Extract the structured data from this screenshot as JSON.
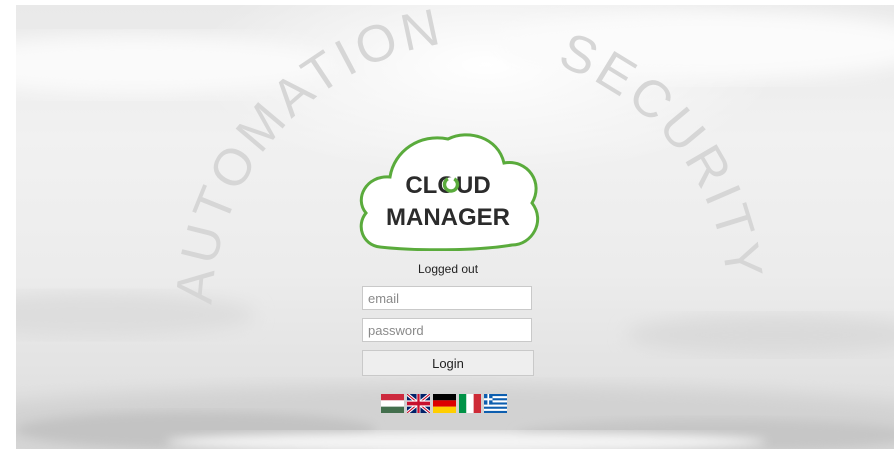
{
  "logo": {
    "line1": "CLOUD",
    "line2": "MANAGER",
    "accent_color": "#5aab3c"
  },
  "arc": {
    "left_word": "AUTOMATION",
    "right_word": "SECURITY"
  },
  "status_text": "Logged out",
  "form": {
    "email_placeholder": "email",
    "password_placeholder": "password",
    "login_label": "Login"
  },
  "languages": [
    {
      "name": "hungarian-flag-icon"
    },
    {
      "name": "uk-flag-icon"
    },
    {
      "name": "german-flag-icon"
    },
    {
      "name": "italian-flag-icon"
    },
    {
      "name": "greek-flag-icon"
    }
  ]
}
